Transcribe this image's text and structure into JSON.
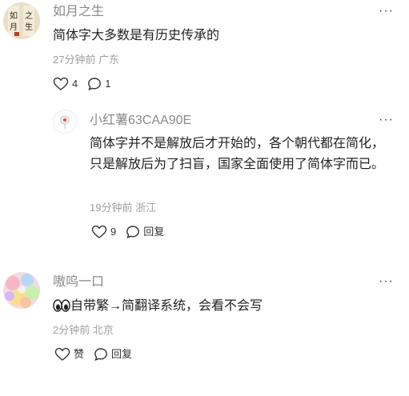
{
  "comments": [
    {
      "user": "如月之生",
      "text": "简体字大多数是有历史传承的",
      "time": "27分钟前",
      "location": "广东",
      "likes": "4",
      "replies": "1"
    },
    {
      "user": "小红薯63CAA90E",
      "text": "简体字并不是解放后才开始的，各个朝代都在简化，只是解放后为了扫盲，国家全面使用了简体字而已。",
      "time": "19分钟前",
      "location": "浙江",
      "likes": "9",
      "replies": "回复"
    },
    {
      "user": "嗷呜一口",
      "emoji": "eyes-emoji",
      "text": "自带繁→简翻译系统，会看不会写",
      "time": "2分钟前",
      "location": "北京",
      "likes": "赞",
      "replies": "回复"
    }
  ],
  "icons": {
    "more": "more-dots-icon",
    "like": "heart-outline-icon",
    "reply": "speech-bubble-icon"
  },
  "colors": {
    "meta": "#a0a0a0",
    "username": "#8a8a8a",
    "text": "#222222"
  }
}
